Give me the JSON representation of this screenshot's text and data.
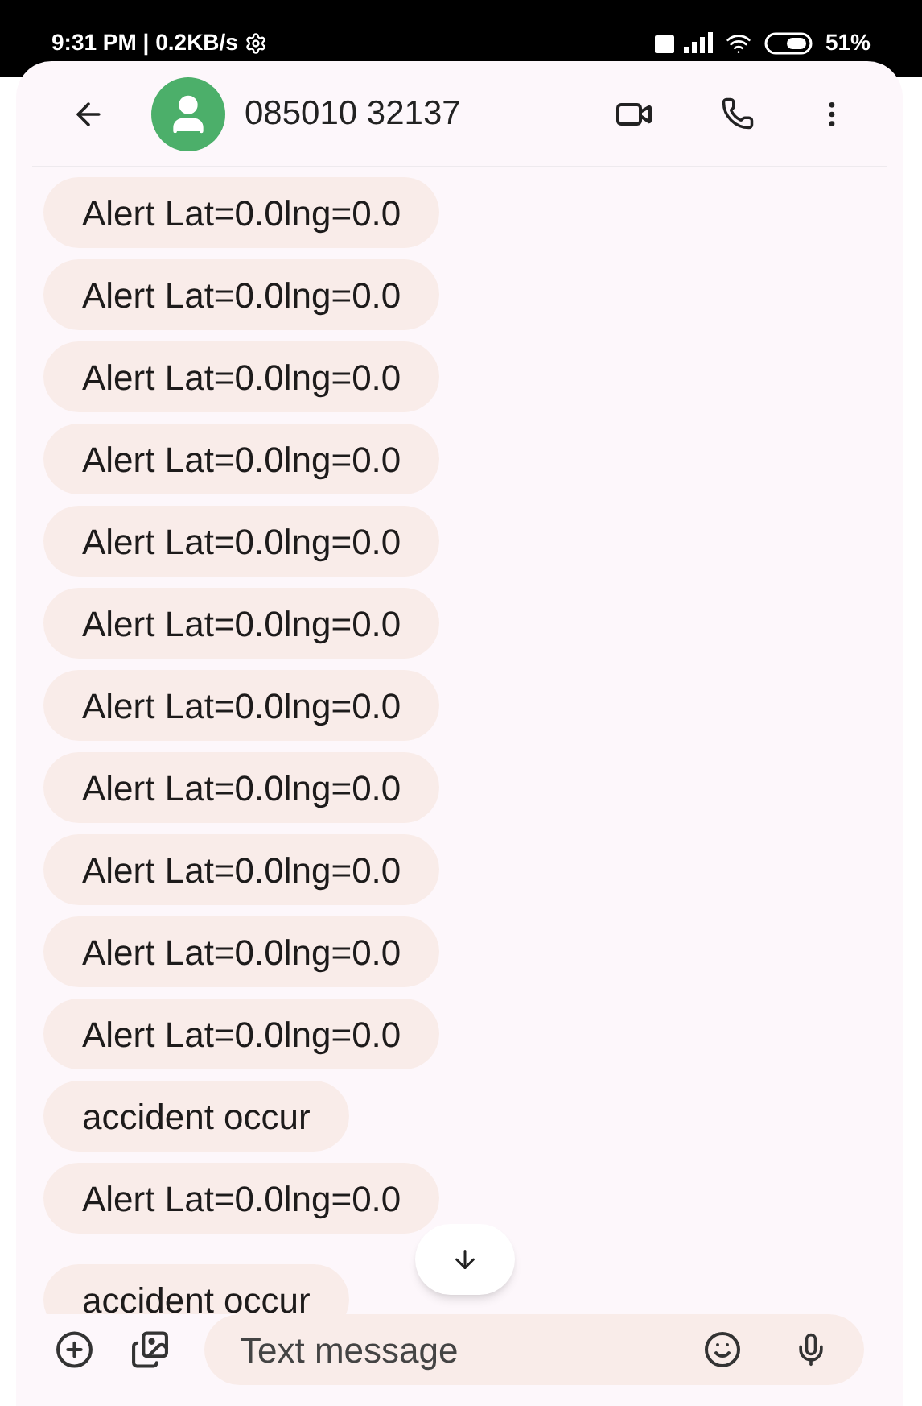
{
  "status_bar": {
    "time": "9:31 PM | 0.2KB/s",
    "battery": "51%"
  },
  "header": {
    "contact": "085010 32137"
  },
  "messages": [
    {
      "text": "Alert Lat=0.0lng=0.0"
    },
    {
      "text": "Alert Lat=0.0lng=0.0"
    },
    {
      "text": "Alert Lat=0.0lng=0.0"
    },
    {
      "text": "Alert Lat=0.0lng=0.0"
    },
    {
      "text": "Alert Lat=0.0lng=0.0"
    },
    {
      "text": "Alert Lat=0.0lng=0.0"
    },
    {
      "text": "Alert Lat=0.0lng=0.0"
    },
    {
      "text": "Alert Lat=0.0lng=0.0"
    },
    {
      "text": "Alert Lat=0.0lng=0.0"
    },
    {
      "text": "Alert Lat=0.0lng=0.0"
    },
    {
      "text": "Alert Lat=0.0lng=0.0"
    },
    {
      "text": "accident occur"
    },
    {
      "text": "Alert Lat=0.0lng=0.0"
    },
    {
      "text": "accident occur"
    }
  ],
  "composer": {
    "placeholder": "Text message"
  }
}
